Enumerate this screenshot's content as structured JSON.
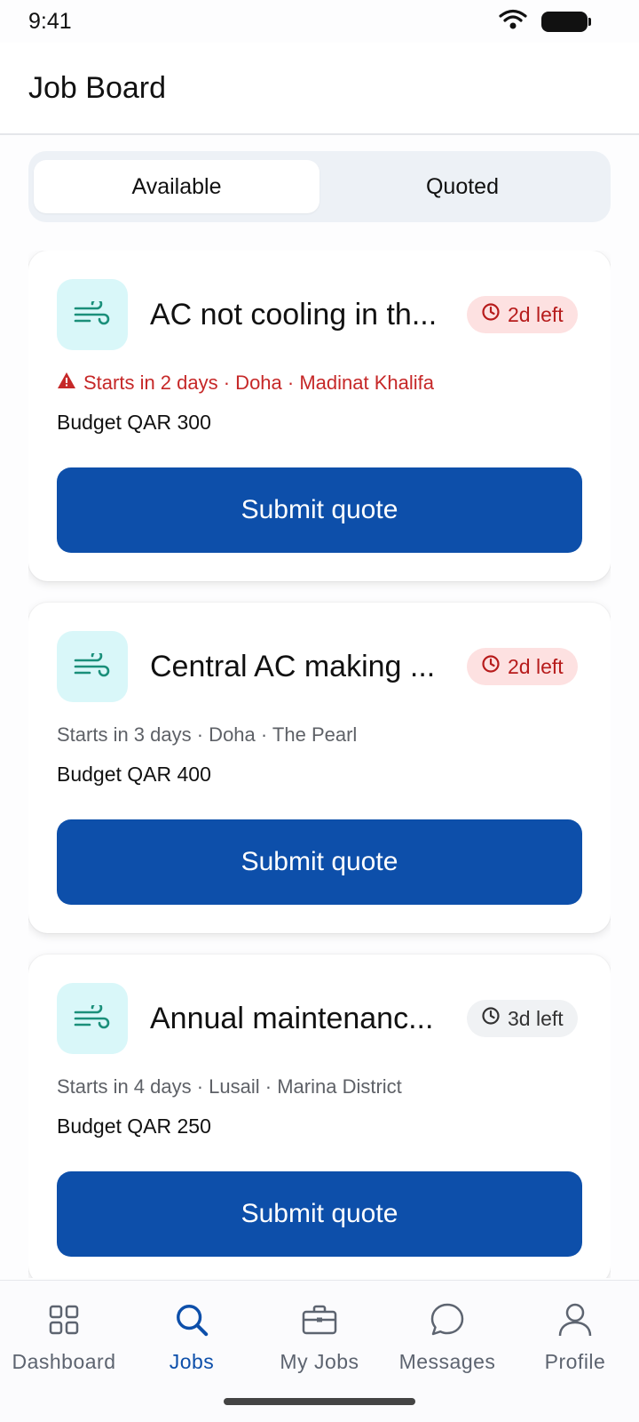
{
  "status_bar": {
    "time": "9:41"
  },
  "header": {
    "title": "Job Board"
  },
  "tabs": [
    {
      "label": "Available",
      "active": true
    },
    {
      "label": "Quoted",
      "active": false
    }
  ],
  "jobs": [
    {
      "title": "AC not cooling in th...",
      "deadline": "2d left",
      "urgent": true,
      "meta": "Starts in 2 days · Doha · Madinat Khalifa",
      "budget": "Budget QAR 300",
      "action": "Submit quote"
    },
    {
      "title": "Central AC making ...",
      "deadline": "2d left",
      "urgent": true,
      "meta": "Starts in 3 days · Doha · The Pearl",
      "budget": "Budget QAR 400",
      "action": "Submit quote"
    },
    {
      "title": "Annual maintenanc...",
      "deadline": "3d left",
      "urgent": false,
      "meta": "Starts in 4 days · Lusail · Marina District",
      "budget": "Budget QAR 250",
      "action": "Submit quote"
    }
  ],
  "bottom_nav": [
    {
      "label": "Dashboard",
      "icon": "grid-icon",
      "active": false
    },
    {
      "label": "Jobs",
      "icon": "search-icon",
      "active": true
    },
    {
      "label": "My Jobs",
      "icon": "briefcase-icon",
      "active": false
    },
    {
      "label": "Messages",
      "icon": "chat-bubble-icon",
      "active": false
    },
    {
      "label": "Profile",
      "icon": "person-icon",
      "active": false
    }
  ],
  "colors": {
    "primary": "#0d4faa",
    "urgent_text": "#c62828",
    "urgent_badge_bg": "#fde1e1",
    "icon_tile_bg": "#d9f7f9",
    "icon_accent": "#1a8f7a"
  }
}
